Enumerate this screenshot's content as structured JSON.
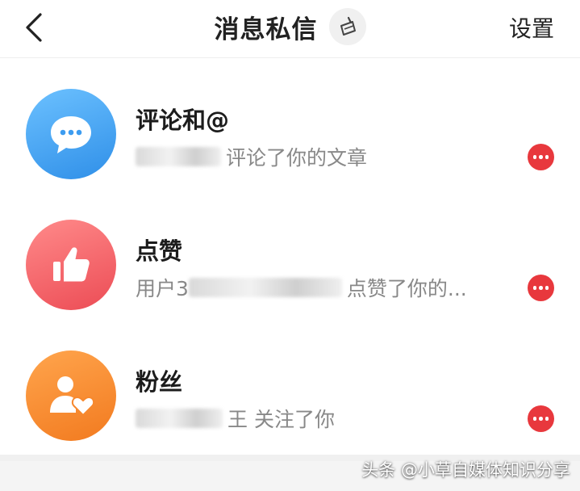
{
  "header": {
    "title": "消息私信",
    "settings_label": "设置",
    "back_icon": "chevron-left-icon",
    "clean_icon": "broom-icon"
  },
  "messages": [
    {
      "title": "评论和@",
      "subtitle": "评论了你的文章",
      "icon": "chat-bubble-icon",
      "color": "#3d9cf0"
    },
    {
      "title": "点赞",
      "subtitle_prefix": "用户3",
      "subtitle": "点赞了你的...",
      "icon": "thumbs-up-icon",
      "color": "#ef5a62"
    },
    {
      "title": "粉丝",
      "subtitle_suffix": "王",
      "subtitle": "关注了你",
      "icon": "user-heart-icon",
      "color": "#f7882d"
    }
  ],
  "badge_color": "#e8383d",
  "watermark": "头条 @小草自媒体知识分享"
}
